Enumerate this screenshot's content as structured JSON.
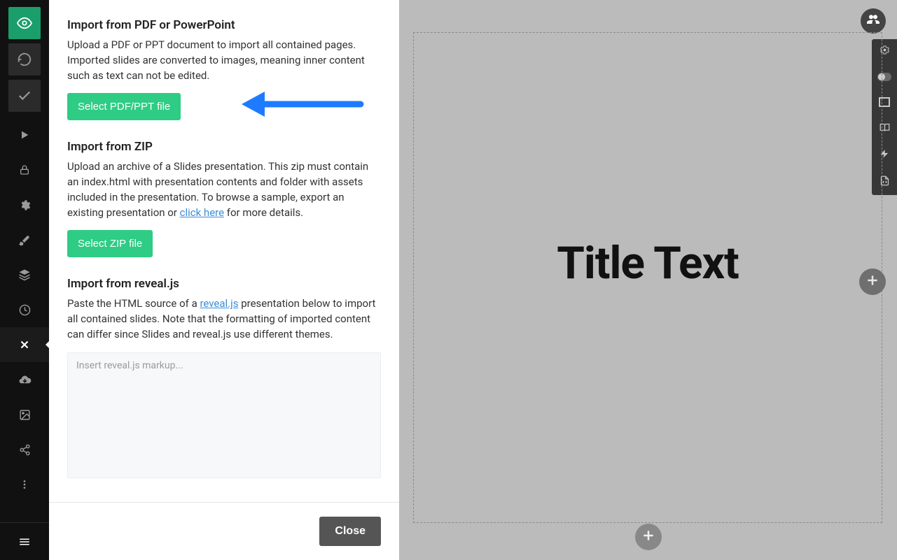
{
  "import": {
    "pdf": {
      "heading": "Import from PDF or PowerPoint",
      "description": "Upload a PDF or PPT document to import all contained pages. Imported slides are converted to images, meaning inner content such as text can not be edited.",
      "button": "Select PDF/PPT file"
    },
    "zip": {
      "heading": "Import from ZIP",
      "description_prefix": "Upload an archive of a Slides presentation. This zip must contain an index.html with presentation contents and folder with assets included in the presentation. To browse a sample, export an existing presentation or ",
      "link": "click here",
      "description_suffix": " for more details.",
      "button": "Select ZIP file"
    },
    "reveal": {
      "heading": "Import from reveal.js",
      "description_prefix": "Paste the HTML source of a ",
      "link": "reveal.js",
      "description_suffix": " presentation below to import all contained slides. Note that the formatting of imported content can differ since Slides and reveal.js use different themes.",
      "placeholder": "Insert reveal.js markup..."
    },
    "close": "Close"
  },
  "canvas": {
    "slide_title": "Title Text"
  },
  "colors": {
    "accent_green": "#2ecc84",
    "arrow_blue": "#1e7bff"
  }
}
